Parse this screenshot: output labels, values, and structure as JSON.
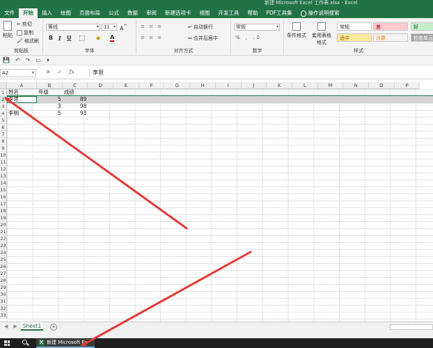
{
  "window": {
    "title": "新建 Microsoft Excel 工作表.xlsx - Excel"
  },
  "menu_tabs": [
    {
      "label": "文件",
      "active": false
    },
    {
      "label": "开始",
      "active": true
    },
    {
      "label": "插入",
      "active": false
    },
    {
      "label": "绘图",
      "active": false
    },
    {
      "label": "页面布局",
      "active": false
    },
    {
      "label": "公式",
      "active": false
    },
    {
      "label": "数据",
      "active": false
    },
    {
      "label": "审阅",
      "active": false
    },
    {
      "label": "新建选项卡",
      "active": false
    },
    {
      "label": "视图",
      "active": false
    },
    {
      "label": "开发工具",
      "active": false
    },
    {
      "label": "帮助",
      "active": false
    },
    {
      "label": "PDF工具集",
      "active": false
    }
  ],
  "help_search": "操作说明搜索",
  "ribbon": {
    "clipboard": {
      "label": "剪贴板",
      "paste": "粘贴",
      "cut": "剪切",
      "copy": "复制",
      "painter": "格式刷"
    },
    "font": {
      "label": "字体",
      "name": "等线",
      "size": "11",
      "bold": "B",
      "italic": "I",
      "underline": "U"
    },
    "alignment": {
      "label": "对齐方式",
      "wrap": "自动换行",
      "merge": "合并后居中"
    },
    "number": {
      "label": "数字",
      "format": "常规"
    },
    "styles": {
      "label": "样式",
      "conditional": "条件格式",
      "table": "套用表格格式",
      "cells": [
        {
          "label": "常规",
          "bg": "#ffffff",
          "fg": "#333333"
        },
        {
          "label": "差",
          "bg": "#ffc7ce",
          "fg": "#9c0006"
        },
        {
          "label": "好",
          "bg": "#c6efce",
          "fg": "#006100"
        },
        {
          "label": "适中",
          "bg": "#ffeb9c",
          "fg": "#9c5700"
        },
        {
          "label": "计算",
          "bg": "#f2f2f2",
          "fg": "#fa7d00"
        },
        {
          "label": "检查单元",
          "bg": "#a5a5a5",
          "fg": "#ffffff"
        }
      ]
    }
  },
  "formula_bar": {
    "name_box": "A2",
    "fx": "fx",
    "cancel": "✕",
    "confirm": "✓",
    "content": "李思"
  },
  "grid": {
    "columns": [
      "A",
      "B",
      "C",
      "D",
      "E",
      "F",
      "G",
      "H",
      "I",
      "J",
      "K",
      "L",
      "M",
      "N",
      "O",
      "P"
    ],
    "rows": [
      "1",
      "2",
      "3",
      "4",
      "5",
      "6",
      "7",
      "8",
      "9",
      "10",
      "11",
      "12",
      "13",
      "14",
      "15",
      "16",
      "17",
      "18",
      "19",
      "20",
      "21",
      "22",
      "23",
      "24",
      "25",
      "26",
      "27",
      "28",
      "29",
      "30",
      "31",
      "32",
      "33"
    ],
    "cells": [
      {
        "ref": "A1",
        "value": "姓名",
        "type": "text"
      },
      {
        "ref": "B1",
        "value": "年级",
        "type": "text"
      },
      {
        "ref": "C1",
        "value": "成绩",
        "type": "text"
      },
      {
        "ref": "A2",
        "value": "李思",
        "type": "text"
      },
      {
        "ref": "B2",
        "value": "5",
        "type": "num"
      },
      {
        "ref": "C2",
        "value": "89",
        "type": "num"
      },
      {
        "ref": "B3",
        "value": "3",
        "type": "num"
      },
      {
        "ref": "C3",
        "value": "98",
        "type": "num"
      },
      {
        "ref": "A4",
        "value": "李明",
        "type": "text"
      },
      {
        "ref": "B4",
        "value": "5",
        "type": "num"
      },
      {
        "ref": "C4",
        "value": "93",
        "type": "num"
      }
    ],
    "selected_row": "2"
  },
  "sheets": {
    "tabs": [
      "Sheet1"
    ],
    "add": "+"
  },
  "taskbar": {
    "app_label": "新建 Microsoft Ex"
  },
  "colors": {
    "accent": "#217346",
    "arrow": "#e53935"
  }
}
